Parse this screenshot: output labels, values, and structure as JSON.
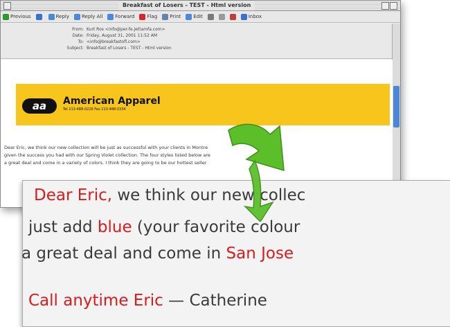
{
  "window": {
    "title": "Breakfast of Losers - TEST - Html version"
  },
  "toolbar": {
    "items": [
      "Previous",
      "",
      "Reply",
      "Reply All",
      "Forward",
      "Flag",
      "Print",
      "Edit",
      "",
      "",
      "",
      "Inbox"
    ]
  },
  "headers": [
    {
      "label": "From:",
      "value": "Kurt Ros <info@per-fe.jettamfa.com>"
    },
    {
      "label": "Date:",
      "value": "Friday, August 31, 2001 11:52 AM"
    },
    {
      "label": "To:",
      "value": "<info@breakfastofl.com>"
    },
    {
      "label": "Subject:",
      "value": "Breakfast of Losers - TEST - Html version"
    }
  ],
  "banner": {
    "logo": "aa",
    "brand": "American Apparel",
    "tel": "Tel 213-488-0226  Fax 213-488-0334"
  },
  "body_lines": [
    "Dear Eric, we think our new collection will be just as successful with your clients in Montre",
    "given the success you had with our Spring Violet collection. The four styles listed below are",
    "a great deal and come in a variety of colors. I think they are going to be our hottest seller"
  ],
  "zoom": {
    "line1": {
      "greeting": "Dear Eric,",
      "rest": "we think our new collec"
    },
    "line2": {
      "pre": "just add",
      "color": "blue",
      "post": "(your favorite colour"
    },
    "line3": {
      "pre": "a great deal and come in",
      "city": "San Jose"
    },
    "line4": {
      "call": "Call anytime Eric",
      "sign": "— Catherine"
    }
  },
  "colors": {
    "banner": "#f7c51b",
    "highlight": "#d81c1c",
    "arrow": "#5cbf2a"
  }
}
